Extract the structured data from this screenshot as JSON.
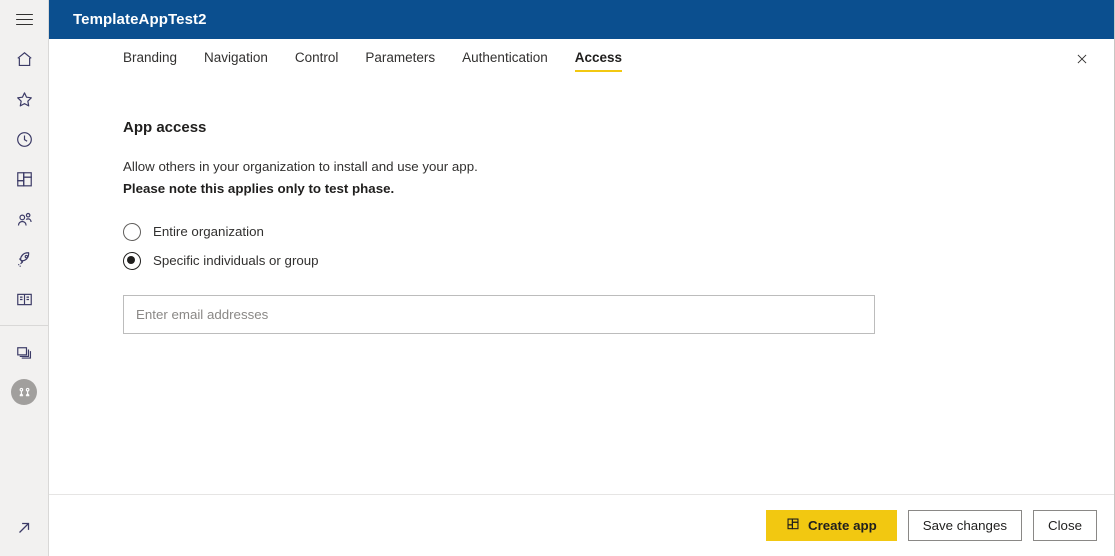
{
  "sidebar": {
    "menu_toggle": "hamburger-menu",
    "items": [
      {
        "name": "home",
        "icon": "home-icon"
      },
      {
        "name": "favorites",
        "icon": "star-icon"
      },
      {
        "name": "recent",
        "icon": "clock-icon"
      },
      {
        "name": "apps",
        "icon": "grid-apps-icon"
      },
      {
        "name": "shared-with-me",
        "icon": "people-icon"
      },
      {
        "name": "deployment-pipelines",
        "icon": "rocket-icon"
      },
      {
        "name": "learn",
        "icon": "book-icon"
      },
      {
        "name": "workspaces",
        "icon": "workspaces-icon"
      }
    ],
    "workspace_avatar": "workspace-avatar-icon",
    "bottom_action": "expand-arrow-icon"
  },
  "header": {
    "title": "TemplateAppTest2"
  },
  "tabs": [
    {
      "label": "Branding",
      "active": false
    },
    {
      "label": "Navigation",
      "active": false
    },
    {
      "label": "Control",
      "active": false
    },
    {
      "label": "Parameters",
      "active": false
    },
    {
      "label": "Authentication",
      "active": false
    },
    {
      "label": "Access",
      "active": true
    }
  ],
  "close_button": {
    "icon": "close-icon"
  },
  "main": {
    "section_title": "App access",
    "description_line1": "Allow others in your organization to install and use your app.",
    "description_line2": "Please note this applies only to test phase.",
    "options": [
      {
        "label": "Entire organization",
        "selected": false
      },
      {
        "label": "Specific individuals or group",
        "selected": true
      }
    ],
    "email_field": {
      "placeholder": "Enter email addresses",
      "value": ""
    }
  },
  "footer": {
    "create_app_label": "Create app",
    "create_app_icon": "grid-apps-icon",
    "save_changes_label": "Save changes",
    "close_label": "Close"
  },
  "colors": {
    "header_blue": "#0b4f8f",
    "accent_yellow": "#f2c811",
    "sidebar_bg": "#f2f1f0",
    "text_primary": "#201f1e"
  }
}
